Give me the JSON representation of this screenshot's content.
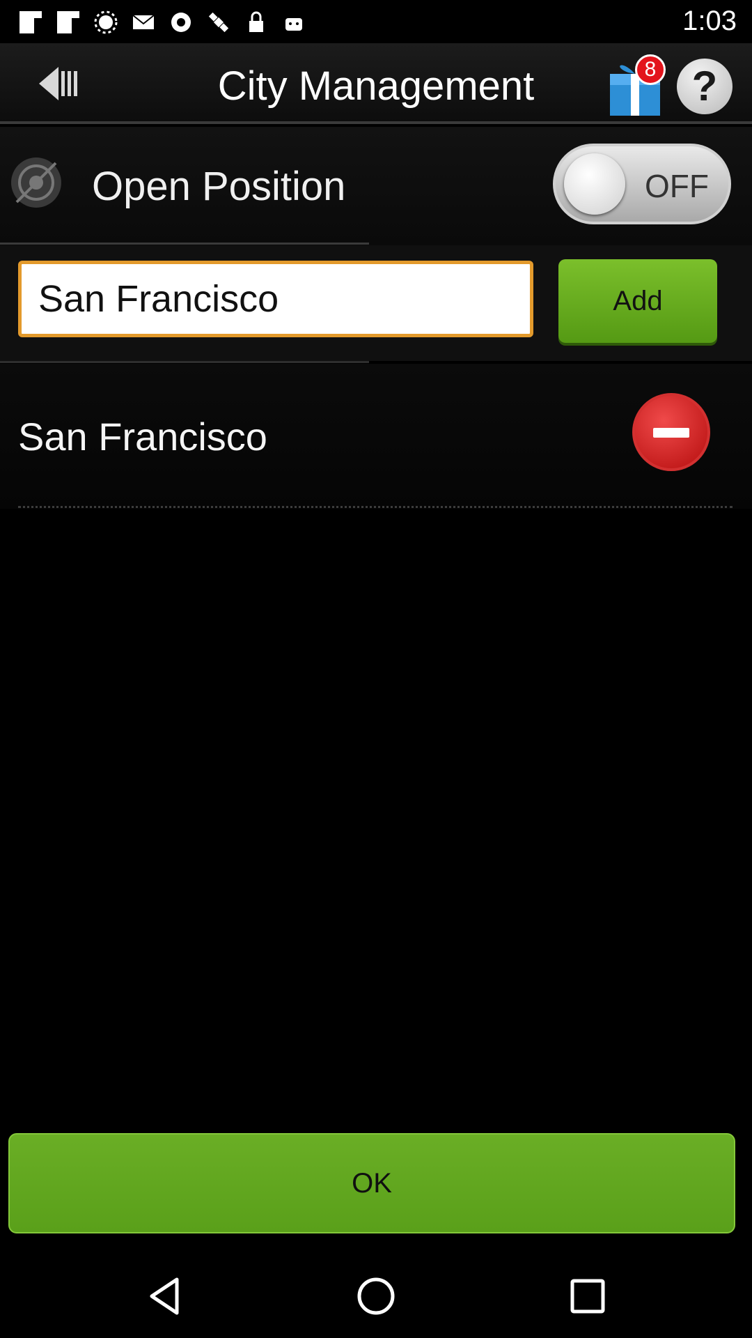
{
  "status_bar": {
    "time": "1:03",
    "icons": [
      "flipboard-icon",
      "flipboard-icon",
      "brightness-icon",
      "email-icon",
      "settings-icon",
      "satellite-icon",
      "lock-icon",
      "android-icon"
    ]
  },
  "header": {
    "title": "City Management",
    "back_icon": "back-icon",
    "gift_icon": "gift-icon",
    "gift_badge_count": "8",
    "help_icon": "help-icon",
    "help_glyph": "?"
  },
  "position": {
    "label": "Open Position",
    "toggle_state": "OFF",
    "icon": "location-icon"
  },
  "add_city": {
    "input_value": "San Francisco",
    "add_label": "Add"
  },
  "cities": [
    {
      "name": "San Francisco",
      "remove_icon": "remove-icon"
    }
  ],
  "footer": {
    "ok_label": "OK"
  },
  "nav": {
    "back": "back-nav-icon",
    "home": "home-nav-icon",
    "recents": "recents-nav-icon"
  },
  "colors": {
    "accent_green": "#6aae25",
    "input_border": "#e39a2c",
    "badge_red": "#e3141c",
    "remove_red": "#c81a1a"
  }
}
